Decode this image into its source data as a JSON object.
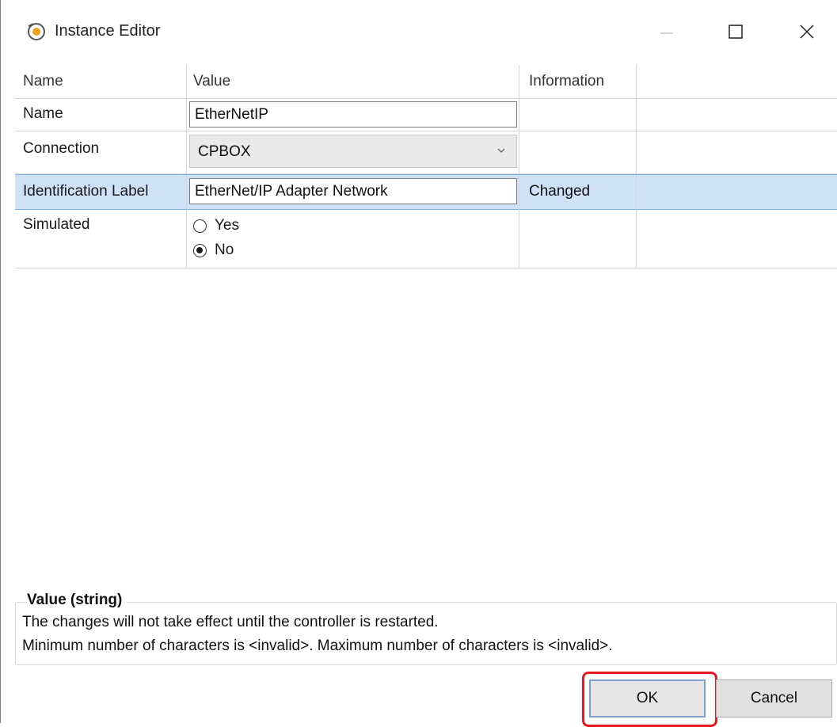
{
  "window": {
    "title": "Instance Editor",
    "icon": "instance-editor-icon",
    "controls": [
      "minimize-icon",
      "maximize-icon",
      "close-icon"
    ]
  },
  "grid": {
    "headers": {
      "name": "Name",
      "value": "Value",
      "information": "Information"
    },
    "rows": {
      "name": {
        "label": "Name",
        "value": "EtherNetIP",
        "info": ""
      },
      "connection": {
        "label": "Connection",
        "value": "CPBOX",
        "info": ""
      },
      "identification": {
        "label": "Identification Label",
        "value": "EtherNet/IP Adapter Network",
        "info": "Changed"
      },
      "simulated": {
        "label": "Simulated",
        "options": {
          "yes": "Yes",
          "no": "No"
        },
        "selected": "No"
      }
    }
  },
  "description": {
    "title": "Value (string)",
    "line1": "The changes will not take effect until the controller is restarted.",
    "line2": "Minimum number of characters is <invalid>. Maximum number of characters is <invalid>."
  },
  "buttons": {
    "ok": "OK",
    "cancel": "Cancel"
  },
  "colors": {
    "selected_row": "#cfe1f7",
    "highlight": "#e8191e"
  }
}
